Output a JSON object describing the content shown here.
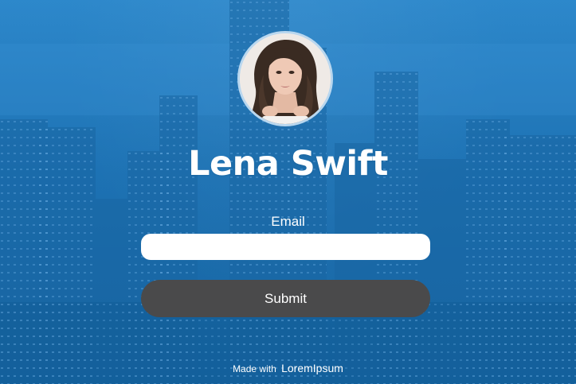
{
  "profile": {
    "name": "Lena Swift"
  },
  "form": {
    "email_label": "Email",
    "email_value": "",
    "email_placeholder": "",
    "submit_label": "Submit"
  },
  "footer": {
    "made_with": "Made with",
    "brand": "LoremIpsum"
  },
  "theme": {
    "overlay": "#1b72b6",
    "button": "#4a4a4b",
    "text": "#ffffff"
  }
}
